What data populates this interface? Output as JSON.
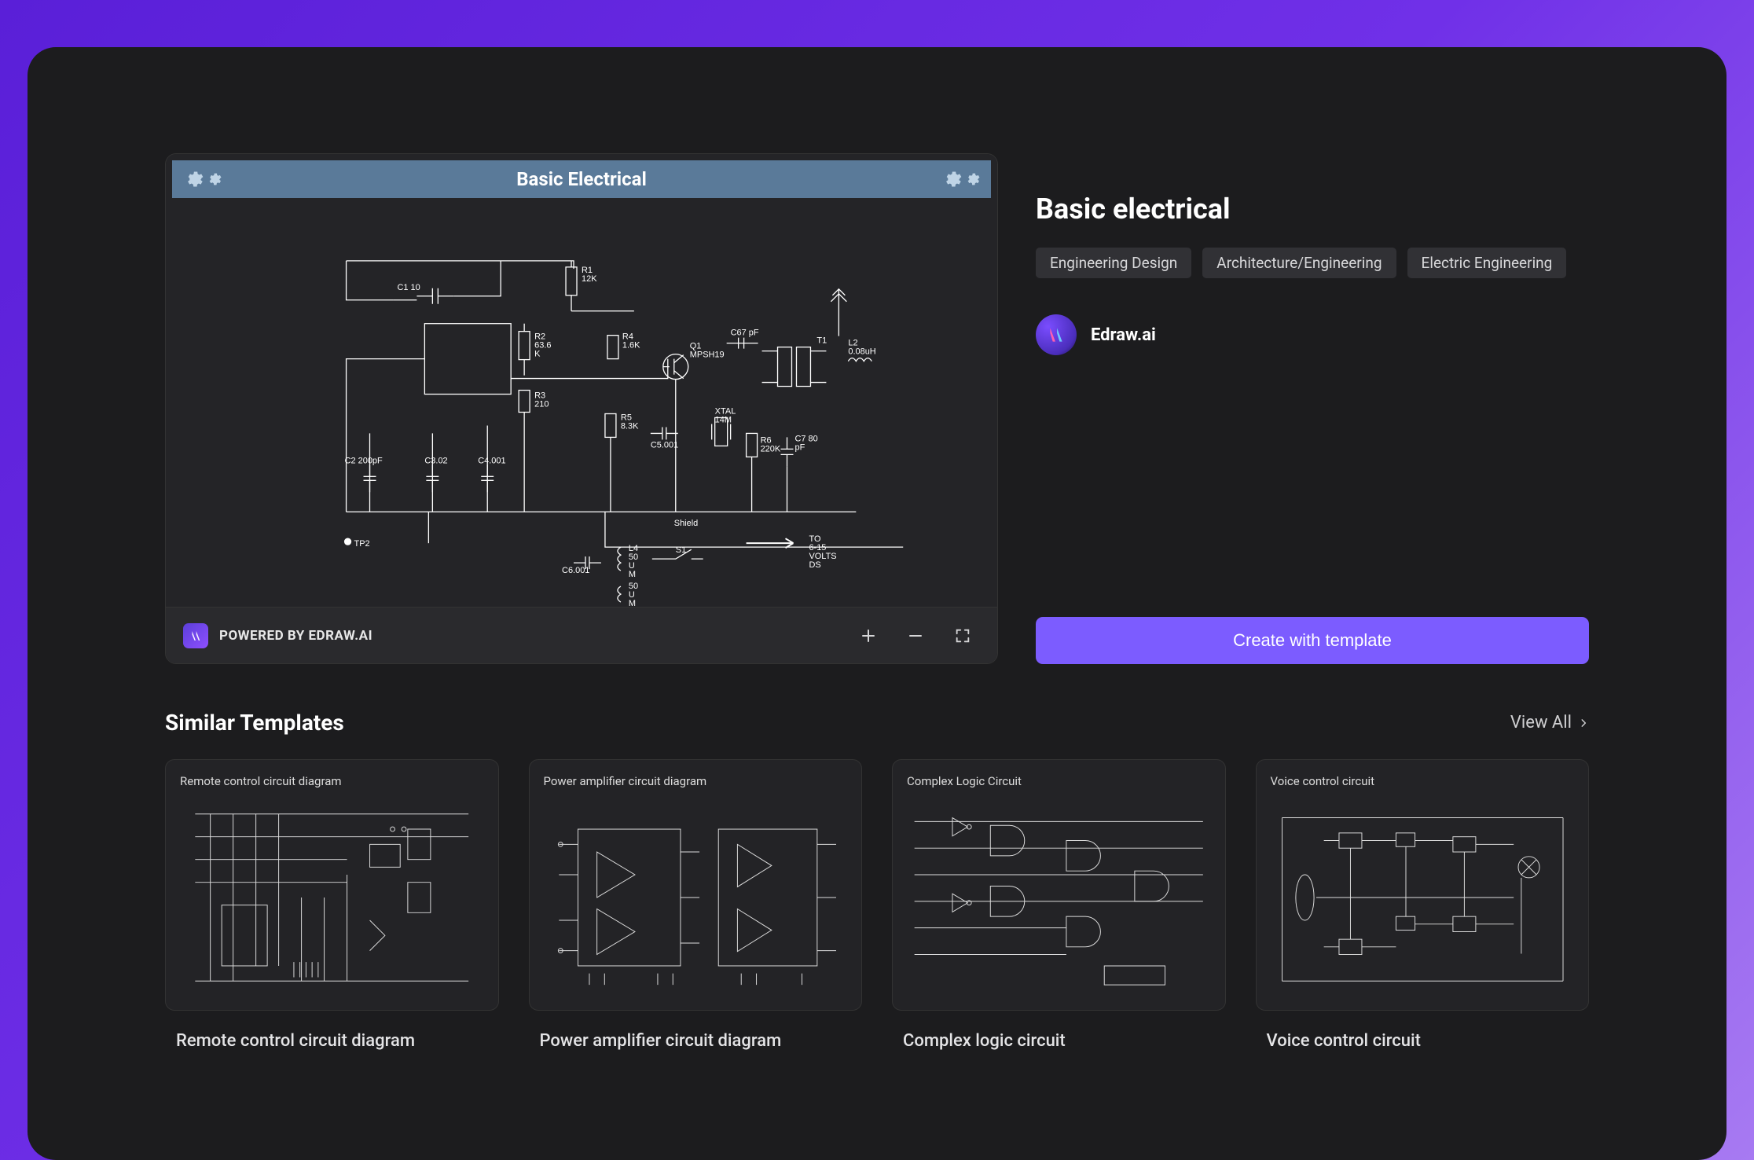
{
  "preview": {
    "diagram_title": "Basic Electrical",
    "powered_by": "POWERED BY EDRAW.AI",
    "components": {
      "c1": "C1 10",
      "r1": "R1\n12K",
      "r2": "R2\n63.6\nK",
      "r3": "R3\n210",
      "r4": "R4\n1.6K",
      "q1": "Q1\nMPSH19",
      "c67": "C67 pF",
      "r5": "R5\n8.3K",
      "c5": "C5.001",
      "xtal": "XTAL\n14M",
      "c2": "C2 200pF",
      "c3": "C3.02",
      "c4": "C4.001",
      "c6": "C6.001",
      "r6": "R6\n220K",
      "c7": "C7 80\npF",
      "t1": "T1",
      "l2": "L2\n0.08uH",
      "l4": "L4\n50\nU\nM",
      "l5": "50\nU\nM",
      "s1": "S1",
      "tp2": "TP2",
      "shield": "Shield",
      "volts": "TO\n6-15\nVOLTS\nDS"
    }
  },
  "info": {
    "title": "Basic electrical",
    "tags": [
      "Engineering Design",
      "Architecture/Engineering",
      "Electric Engineering"
    ],
    "author": "Edraw.ai",
    "create_button": "Create with template"
  },
  "similar": {
    "heading": "Similar Templates",
    "view_all": "View All",
    "templates": [
      {
        "thumb_title": "Remote control circuit diagram",
        "label": "Remote control circuit diagram"
      },
      {
        "thumb_title": "Power amplifier circuit diagram",
        "label": "Power amplifier circuit diagram"
      },
      {
        "thumb_title": "Complex Logic Circuit",
        "label": "Complex logic circuit"
      },
      {
        "thumb_title": "Voice control circuit",
        "label": "Voice control circuit"
      }
    ]
  }
}
